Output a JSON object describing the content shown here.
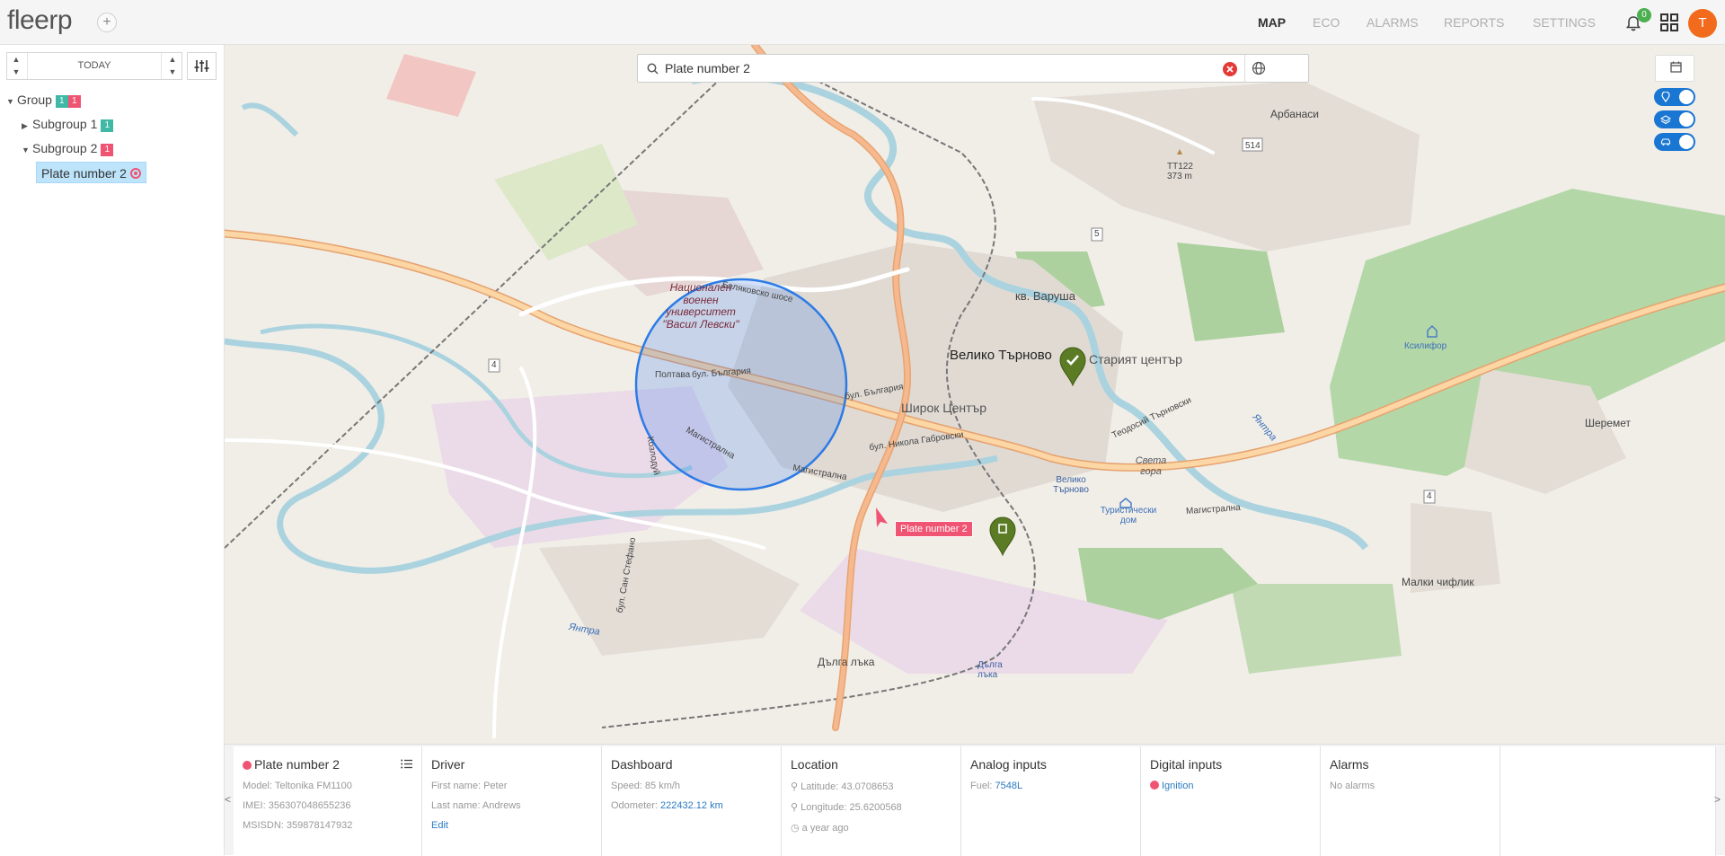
{
  "app": {
    "logo": "fleerp",
    "add_label": "+"
  },
  "nav": {
    "map": "MAP",
    "eco": "ECO",
    "alarms": "ALARMS",
    "reports": "REPORTS",
    "settings": "SETTINGS"
  },
  "notifications": {
    "count": "0"
  },
  "user": {
    "initial": "T"
  },
  "sidebar": {
    "date_label": "TODAY",
    "tree": {
      "group": {
        "label": "Group",
        "online": "1",
        "offline": "1"
      },
      "subgroup1": {
        "label": "Subgroup 1",
        "online": "1"
      },
      "subgroup2": {
        "label": "Subgroup 2",
        "offline": "1"
      },
      "vehicle": {
        "label": "Plate number 2"
      }
    }
  },
  "map": {
    "search_value": "Plate number 2",
    "tooltip": "Plate number 2",
    "labels": {
      "city": "Велико Търново",
      "old_center": "Старият център",
      "varusha": "кв. Варуша",
      "shirok": "Широк Център",
      "arbanasi": "Арбанаси",
      "sheremetya": "Шеремет",
      "malki": "Малки чифлик",
      "dalga": "Дълга лъка",
      "dalga2": "Дълга лъка",
      "ksilifor": "Ксилифор",
      "university": "Национален военен университет \"Васил Левски\"",
      "tt": "ТТ122",
      "tt_alt": "373 m",
      "sveta_gora": "Света гора",
      "vt_station": "Велико Търново",
      "tourist": "Туристически дом",
      "yantra1": "Янтра",
      "yantra2": "Янтра",
      "poltava": "Полтава",
      "bul_bulgaria": "бул. България",
      "bul_bulgaria2": "бул. България",
      "magistralna": "Магистрална",
      "magistralna2": "Магистрална",
      "magistralna3": "Магистрална",
      "bul_nikola": "бул. Никола Габровски",
      "road_514": "514",
      "road_4a": "4",
      "road_4b": "4",
      "road_5": "5",
      "teodosii": "Теодосий Търновски",
      "belyakovsko": "Беляковско шосе",
      "kozlodui": "Козлодуй",
      "sv_stefan": "бул. Сан Стефано"
    }
  },
  "details": {
    "vehicle": {
      "name": "Plate number 2",
      "model": "Model: Teltonika FM1100",
      "imei": "IMEI: 356307048655236",
      "msisdn": "MSISDN: 359878147932"
    },
    "driver": {
      "title": "Driver",
      "first_name": "First name: Peter",
      "last_name": "Last name: Andrews",
      "edit": "Edit"
    },
    "dashboard": {
      "title": "Dashboard",
      "speed": "Speed: 85 km/h",
      "odometer_label": "Odometer:",
      "odometer_value": "222432.12 km"
    },
    "location": {
      "title": "Location",
      "latitude": "Latitude: 43.0708653",
      "longitude": "Longitude: 25.6200568",
      "time": "a year ago"
    },
    "analog": {
      "title": "Analog inputs",
      "fuel_label": "Fuel:",
      "fuel_value": "7548L"
    },
    "digital": {
      "title": "Digital inputs",
      "ignition": "Ignition"
    },
    "alarms": {
      "title": "Alarms",
      "text": "No alarms"
    }
  },
  "colors": {
    "accent": "#1976d2",
    "offline": "#f05473",
    "online": "#3fb9a6",
    "avatar": "#f26a1b"
  }
}
